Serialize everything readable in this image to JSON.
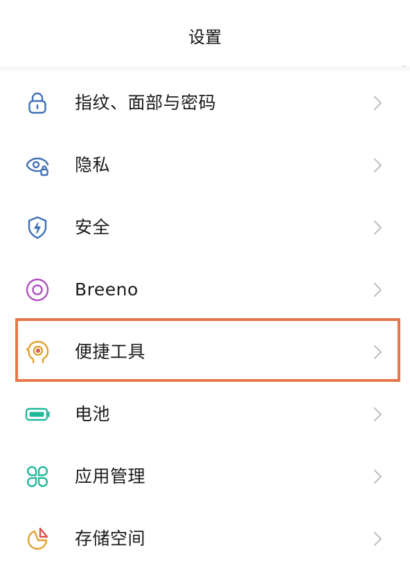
{
  "header": {
    "title": "设置"
  },
  "items": [
    {
      "label": "指纹、面部与密码",
      "icon": "lock-icon",
      "color": "#3e6fb5"
    },
    {
      "label": "隐私",
      "icon": "privacy-eye-lock-icon",
      "color": "#3e6fb5"
    },
    {
      "label": "安全",
      "icon": "shield-bolt-icon",
      "color": "#3e6fb5"
    },
    {
      "label": "Breeno",
      "icon": "breeno-circle-icon",
      "color": "#b04fc0"
    },
    {
      "label": "便捷工具",
      "icon": "head-target-icon",
      "color": "#e0a12a",
      "highlighted": true
    },
    {
      "label": "电池",
      "icon": "battery-icon",
      "color": "#1fb89a"
    },
    {
      "label": "应用管理",
      "icon": "app-grid-icon",
      "color": "#1fb89a"
    },
    {
      "label": "存储空间",
      "icon": "storage-pie-icon",
      "color": "#e0a12a"
    }
  ],
  "highlight_color": "#e8764a"
}
